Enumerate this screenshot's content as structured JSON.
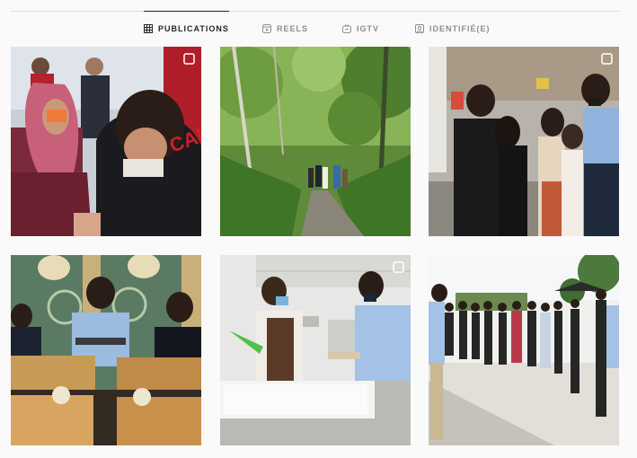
{
  "tabs": [
    {
      "label": "PUBLICATIONS",
      "icon": "grid-icon",
      "active": true
    },
    {
      "label": "REELS",
      "icon": "reels-icon",
      "active": false
    },
    {
      "label": "IGTV",
      "icon": "igtv-icon",
      "active": false
    },
    {
      "label": "IDENTIFIÉ(E)",
      "icon": "tagged-icon",
      "active": false
    }
  ],
  "posts": [
    {
      "subject": "elder woman in headscarf greeting crowd",
      "multi": true
    },
    {
      "subject": "group walking on forest trail",
      "multi": false
    },
    {
      "subject": "masked group meeting in warehouse",
      "multi": true
    },
    {
      "subject": "masked men in ornate bakery with pastries",
      "multi": false
    },
    {
      "subject": "masked men piping in industrial kitchen",
      "multi": true
    },
    {
      "subject": "crowd gathered on outdoor plaza",
      "multi": false
    }
  ],
  "colors": {
    "active_text": "#262626",
    "inactive_text": "#8e8e8e",
    "divider": "#dbdbdb",
    "background": "#fafafa"
  }
}
